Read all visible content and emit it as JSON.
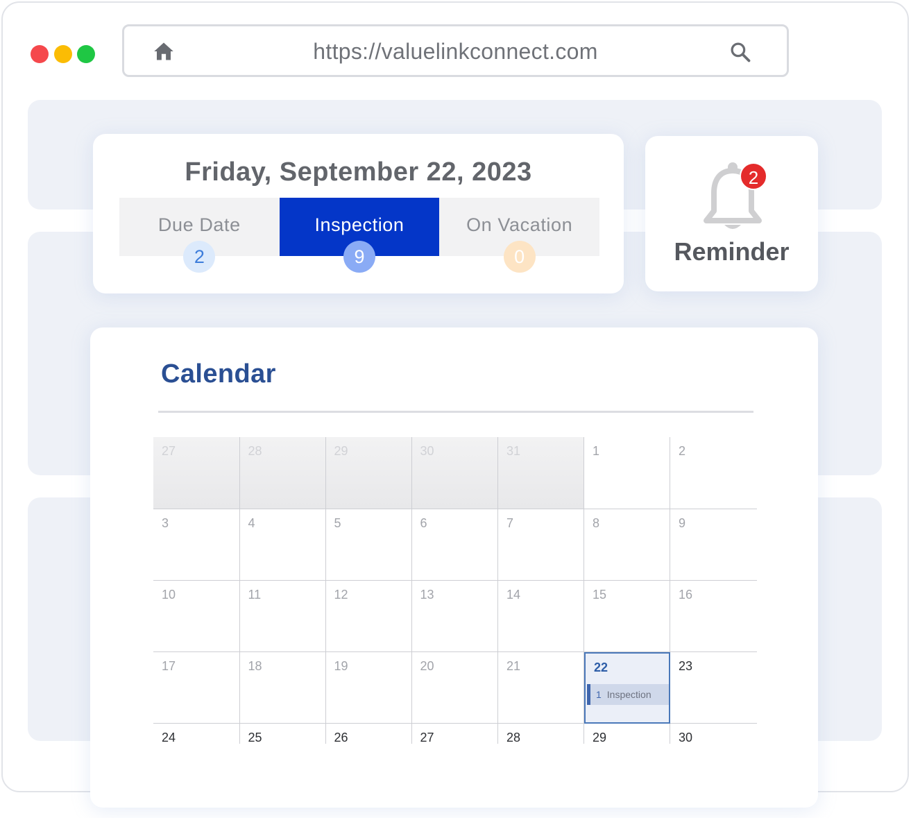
{
  "browser": {
    "url": "https://valuelinkconnect.com",
    "controls": [
      "close",
      "minimize",
      "maximize"
    ],
    "home_icon": "home-icon",
    "search_icon": "search-icon"
  },
  "summary": {
    "date": "Friday, September 22, 2023",
    "tabs": [
      {
        "label": "Due Date",
        "count": "2",
        "active": false
      },
      {
        "label": "Inspection",
        "count": "9",
        "active": true
      },
      {
        "label": "On Vacation",
        "count": "0",
        "active": false
      }
    ],
    "active_color": "#0436c8"
  },
  "reminder": {
    "label": "Reminder",
    "count": "2",
    "icon": "bell-icon"
  },
  "calendar": {
    "title": "Calendar",
    "weeks": [
      [
        "27",
        "28",
        "29",
        "30",
        "31",
        "1",
        "2"
      ],
      [
        "3",
        "4",
        "5",
        "6",
        "7",
        "8",
        "9"
      ],
      [
        "10",
        "11",
        "12",
        "13",
        "14",
        "15",
        "16"
      ],
      [
        "17",
        "18",
        "19",
        "20",
        "21",
        "22",
        "23"
      ],
      [
        "24",
        "25",
        "26",
        "27",
        "28",
        "29",
        "30"
      ]
    ],
    "today": "22",
    "event": {
      "count": "1",
      "label": "Inspection"
    }
  }
}
